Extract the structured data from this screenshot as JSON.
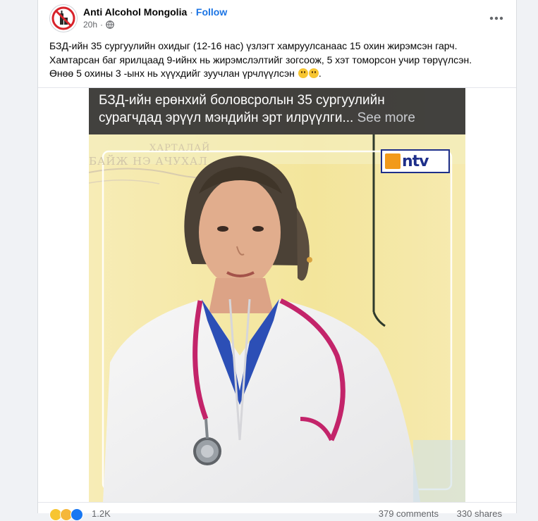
{
  "post": {
    "author": "Anti Alcohol Mongolia",
    "separator": "·",
    "follow_label": "Follow",
    "time_ago": "20h",
    "time_separator": "·",
    "audience_icon": "globe-icon",
    "more_icon": "more-horizontal-icon",
    "text_lines": [
      "БЗД-ийн 35 сургуулийн охидыг (12-16 нас) үзлэгт хамруулсанаас 15 охин жирэмсэн гарч.",
      "Хамтарсан баг ярилцаад 9-ийнх нь жирэмслэлтийг зогсоож, 5 хэт томорсон учир төрүүлсэн.",
      "Өнөө 5 охины 3 -ынх нь хүүхдийг зуучлан үрчлүүлсэн"
    ],
    "text_end": "."
  },
  "video": {
    "caption_line1": "БЗД-ийн ерөнхий боловсролын 35 сургуулийн",
    "caption_line2": "сурагчдад эрүүл мэндийн эрт илрүүлги...",
    "see_more": "See more",
    "channel_logo": "ntv",
    "wall_text_1": "БАЙЖ НЭ АЧУХАЛ",
    "wall_text_2": "ХАРТАЛАЙ"
  },
  "reactions": {
    "count": "1.2K",
    "comments": "379 comments",
    "shares": "330 shares"
  },
  "colors": {
    "brand_blue": "#1b74e4",
    "text_primary": "#050505",
    "text_secondary": "#65676b"
  }
}
